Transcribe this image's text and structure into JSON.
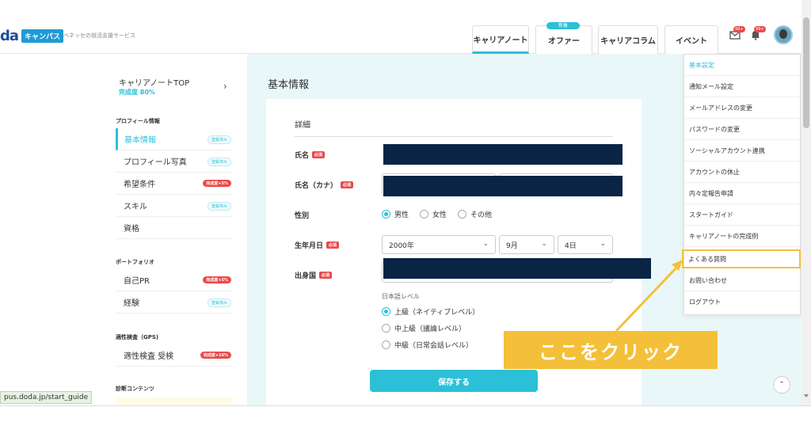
{
  "header": {
    "logo_text": "da",
    "logo_badge": "キャンパス",
    "tagline": "ベネッセの就活支援サービス",
    "tabs": [
      {
        "label": "キャリアノート",
        "active": true
      },
      {
        "label": "オファー",
        "active": false
      },
      {
        "label": "キャリアコラム",
        "active": false
      },
      {
        "label": "イベント",
        "active": false
      }
    ],
    "new_badge": "新着",
    "mail_badge": "99+",
    "bell_badge": "99+"
  },
  "sidebar": {
    "top_title": "キャリアノートTOP",
    "top_progress": "完成度 80%",
    "sections": [
      {
        "heading": "プロフィール情報"
      },
      {
        "heading": "ポートフォリオ"
      },
      {
        "heading": "適性検査（GPS)"
      },
      {
        "heading": "診断コンテンツ"
      }
    ],
    "items": [
      {
        "label": "基本情報",
        "badge": "登録済み",
        "badge_type": "done",
        "active": true
      },
      {
        "label": "プロフィール写真",
        "badge": "登録済み",
        "badge_type": "done",
        "active": false
      },
      {
        "label": "希望条件",
        "badge": "完成度+5%",
        "badge_type": "add",
        "active": false
      },
      {
        "label": "スキル",
        "badge": "登録済み",
        "badge_type": "done",
        "active": false
      },
      {
        "label": "資格",
        "badge": "",
        "badge_type": "",
        "active": false
      },
      {
        "label": "自己PR",
        "badge": "完成度+5%",
        "badge_type": "add",
        "active": false
      },
      {
        "label": "経験",
        "badge": "登録済み",
        "badge_type": "done",
        "active": false
      },
      {
        "label": "適性検査 受検",
        "badge": "完成度+10%",
        "badge_type": "add",
        "active": false
      }
    ],
    "status_url": "pus.doda.jp/start_guide"
  },
  "main": {
    "page_title": "基本情報",
    "section_title": "詳細",
    "fields": {
      "name_label": "氏名",
      "kana_label": "氏名（カナ）",
      "gender_label": "性別",
      "birth_label": "生年月日",
      "origin_label": "出身国",
      "required": "必須"
    },
    "gender_options": [
      {
        "label": "男性",
        "checked": true
      },
      {
        "label": "女性",
        "checked": false
      },
      {
        "label": "その他",
        "checked": false
      }
    ],
    "birth": {
      "year": "2000年",
      "month": "9月",
      "day": "4日"
    },
    "japanese_level_label": "日本語レベル",
    "japanese_levels": [
      {
        "label": "上級（ネイティブレベル）",
        "checked": true
      },
      {
        "label": "中上級（議論レベル）",
        "checked": false
      },
      {
        "label": "中級（日常会話レベル）",
        "checked": false
      }
    ],
    "save_label": "保存する"
  },
  "dropdown": {
    "items": [
      {
        "label": "基本設定",
        "highlight": false
      },
      {
        "label": "通知メール設定",
        "highlight": false
      },
      {
        "label": "メールアドレスの変更",
        "highlight": false
      },
      {
        "label": "パスワードの変更",
        "highlight": false
      },
      {
        "label": "ソーシャルアカウント連携",
        "highlight": false
      },
      {
        "label": "アカウントの休止",
        "highlight": false
      },
      {
        "label": "内々定報告申請",
        "highlight": false
      },
      {
        "label": "スタートガイド",
        "highlight": false
      },
      {
        "label": "キャリアノートの完成例",
        "highlight": false
      },
      {
        "label": "よくある質問",
        "highlight": true
      },
      {
        "label": "お問い合わせ",
        "highlight": false
      },
      {
        "label": "ログアウト",
        "highlight": false
      }
    ]
  },
  "annotation": {
    "callout_text": "ここをクリック"
  },
  "colors": {
    "accent": "#2bc0d8",
    "highlight": "#f4c03a",
    "required": "#e84b4b",
    "redaction": "#0a2446"
  }
}
